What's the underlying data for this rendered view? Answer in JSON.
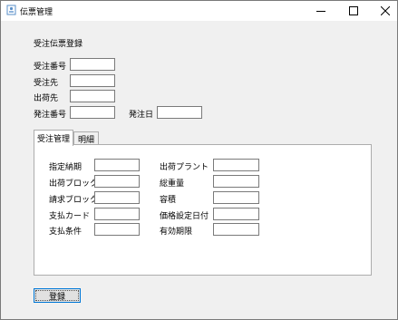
{
  "window": {
    "title": "伝票管理",
    "icons": {
      "app": "app-icon",
      "minimize": "minimize-icon",
      "maximize": "maximize-icon",
      "close": "close-icon"
    }
  },
  "form": {
    "heading": "受注伝票登録",
    "order_number_label": "受注番号",
    "order_number_value": "",
    "customer_label": "受注先",
    "customer_value": "",
    "ship_to_label": "出荷先",
    "ship_to_value": "",
    "po_number_label": "発注番号",
    "po_number_value": "",
    "po_date_label": "発注日",
    "po_date_value": ""
  },
  "tabs": [
    {
      "label": "受注管理",
      "active": true
    },
    {
      "label": "明細",
      "active": false
    }
  ],
  "panel": {
    "left": [
      {
        "label": "指定納期",
        "value": ""
      },
      {
        "label": "出荷ブロック",
        "value": ""
      },
      {
        "label": "請求ブロック",
        "value": ""
      },
      {
        "label": "支払カード",
        "value": ""
      },
      {
        "label": "支払条件",
        "value": ""
      }
    ],
    "right": [
      {
        "label": "出荷プラント",
        "value": ""
      },
      {
        "label": "総重量",
        "value": ""
      },
      {
        "label": "容積",
        "value": ""
      },
      {
        "label": "価格設定日付",
        "value": ""
      },
      {
        "label": "有効期限",
        "value": ""
      }
    ]
  },
  "actions": {
    "submit_label": "登録"
  }
}
